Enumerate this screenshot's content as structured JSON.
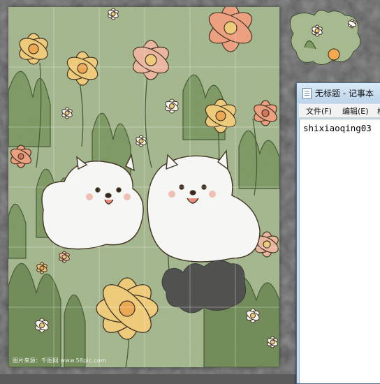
{
  "puzzle": {
    "watermark": "图片来源：千图网 www.58pic.com",
    "palette": {
      "background": "#a6b98f",
      "grass": "#6f8a55",
      "orange_flower": "#f4a07f",
      "yellow_flower": "#f6cf79",
      "pink_flower": "#f2b8a2",
      "dog": "#ffffff",
      "missing_slot": "#4a4a4a"
    }
  },
  "loose_piece": {
    "icon": "puzzle-piece-icon"
  },
  "notepad": {
    "title": "无标题 - 记事本",
    "menu": {
      "file": "文件(F)",
      "edit": "编辑(E)",
      "more": "格"
    },
    "content": "shixiaoqing03"
  }
}
